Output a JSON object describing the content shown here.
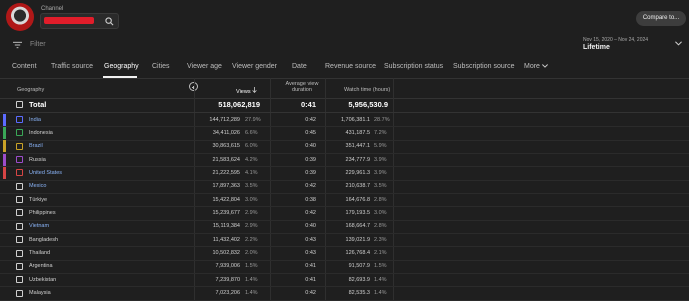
{
  "header": {
    "channel_label": "Channel",
    "compare_button": "Compare to..."
  },
  "filter": {
    "placeholder": "Filter",
    "date_range": "Nov 15, 2020 – Nov 24, 2024",
    "period": "Lifetime"
  },
  "tabs": [
    {
      "label": "Content"
    },
    {
      "label": "Traffic source"
    },
    {
      "label": "Geography"
    },
    {
      "label": "Cities"
    },
    {
      "label": "Viewer age"
    },
    {
      "label": "Viewer gender"
    },
    {
      "label": "Date"
    },
    {
      "label": "Revenue source"
    },
    {
      "label": "Subscription status"
    },
    {
      "label": "Subscription source"
    },
    {
      "label": "More"
    }
  ],
  "active_tab": "Geography",
  "table": {
    "headers": {
      "geography": "Geography",
      "views": "Views",
      "avg_duration_line1": "Average view",
      "avg_duration_line2": "duration",
      "watch_time": "Watch time (hours)"
    },
    "total": {
      "label": "Total",
      "views": "518,062,819",
      "avg_duration": "0:41",
      "watch_time": "5,956,530.9"
    },
    "rows": [
      {
        "name": "India",
        "views": "144,712,289",
        "views_pct": "27.9%",
        "avg": "0:42",
        "watch": "1,706,381.1",
        "watch_pct": "28.7%",
        "link": true,
        "color": "#5c6bff"
      },
      {
        "name": "Indonesia",
        "views": "34,411,026",
        "views_pct": "6.6%",
        "avg": "0:45",
        "watch": "431,187.5",
        "watch_pct": "7.2%",
        "link": false,
        "color": "#3aa757"
      },
      {
        "name": "Brazil",
        "views": "30,863,615",
        "views_pct": "6.0%",
        "avg": "0:40",
        "watch": "351,447.1",
        "watch_pct": "5.9%",
        "link": true,
        "color": "#c9a227"
      },
      {
        "name": "Russia",
        "views": "21,583,624",
        "views_pct": "4.2%",
        "avg": "0:39",
        "watch": "234,777.9",
        "watch_pct": "3.9%",
        "link": false,
        "color": "#9c4dcc"
      },
      {
        "name": "United States",
        "views": "21,222,595",
        "views_pct": "4.1%",
        "avg": "0:39",
        "watch": "229,961.3",
        "watch_pct": "3.9%",
        "link": true,
        "color": "#d64545"
      },
      {
        "name": "Mexico",
        "views": "17,897,363",
        "views_pct": "3.5%",
        "avg": "0:42",
        "watch": "210,638.7",
        "watch_pct": "3.5%",
        "link": true,
        "color": ""
      },
      {
        "name": "Türkiye",
        "views": "15,422,804",
        "views_pct": "3.0%",
        "avg": "0:38",
        "watch": "164,676.8",
        "watch_pct": "2.8%",
        "link": false,
        "color": ""
      },
      {
        "name": "Philippines",
        "views": "15,239,677",
        "views_pct": "2.9%",
        "avg": "0:42",
        "watch": "179,193.5",
        "watch_pct": "3.0%",
        "link": false,
        "color": ""
      },
      {
        "name": "Vietnam",
        "views": "15,119,384",
        "views_pct": "2.9%",
        "avg": "0:40",
        "watch": "168,664.7",
        "watch_pct": "2.8%",
        "link": true,
        "color": ""
      },
      {
        "name": "Bangladesh",
        "views": "11,432,402",
        "views_pct": "2.2%",
        "avg": "0:43",
        "watch": "139,021.9",
        "watch_pct": "2.3%",
        "link": false,
        "color": ""
      },
      {
        "name": "Thailand",
        "views": "10,502,832",
        "views_pct": "2.0%",
        "avg": "0:43",
        "watch": "126,768.4",
        "watch_pct": "2.1%",
        "link": false,
        "color": ""
      },
      {
        "name": "Argentina",
        "views": "7,939,006",
        "views_pct": "1.5%",
        "avg": "0:41",
        "watch": "91,507.9",
        "watch_pct": "1.5%",
        "link": false,
        "color": ""
      },
      {
        "name": "Uzbekistan",
        "views": "7,239,870",
        "views_pct": "1.4%",
        "avg": "0:41",
        "watch": "82,693.9",
        "watch_pct": "1.4%",
        "link": false,
        "color": ""
      },
      {
        "name": "Malaysia",
        "views": "7,023,206",
        "views_pct": "1.4%",
        "avg": "0:42",
        "watch": "82,535.3",
        "watch_pct": "1.4%",
        "link": false,
        "color": ""
      }
    ]
  }
}
